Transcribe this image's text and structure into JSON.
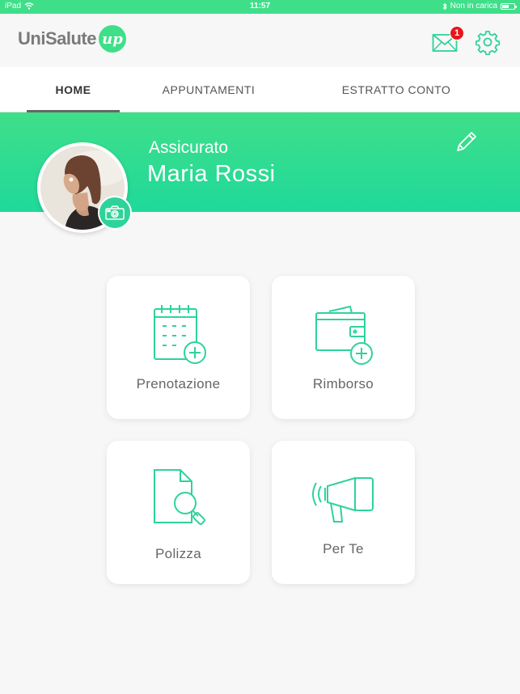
{
  "status_bar": {
    "device": "iPad",
    "time": "11:57",
    "charging": "Non in carica",
    "battery_level": 0.6
  },
  "header": {
    "logo_text": "UniSalute",
    "logo_badge": "up",
    "mail_count": "1"
  },
  "tabs": [
    {
      "label": "HOME",
      "active": true
    },
    {
      "label": "APPUNTAMENTI",
      "active": false
    },
    {
      "label": "ESTRATTO CONTO",
      "active": false
    }
  ],
  "profile": {
    "role": "Assicurato",
    "name": "Maria Rossi"
  },
  "tiles": [
    {
      "label": "Prenotazione",
      "icon": "calendar-add-icon"
    },
    {
      "label": "Rimborso",
      "icon": "wallet-add-icon"
    },
    {
      "label": "Polizza",
      "icon": "document-search-icon"
    },
    {
      "label": "Per Te",
      "icon": "megaphone-icon"
    }
  ],
  "colors": {
    "accent": "#3fdf89",
    "badge": "#e8141b",
    "icon_stroke": "#2ed39a"
  }
}
